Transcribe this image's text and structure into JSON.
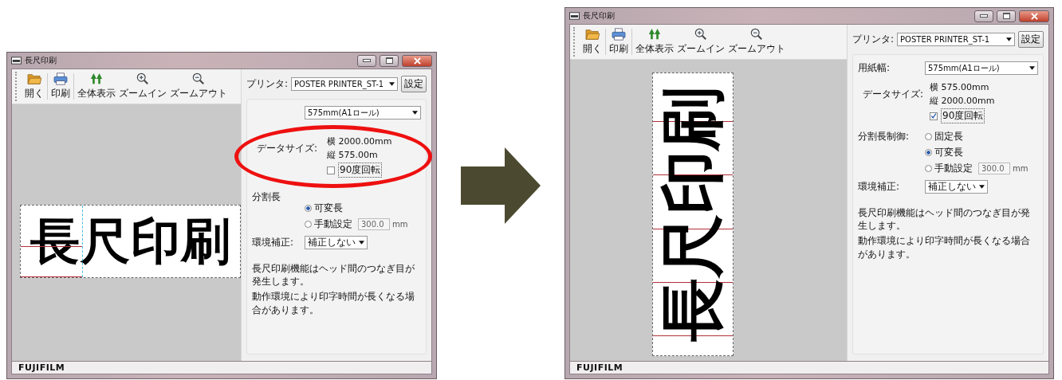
{
  "windows": [
    {
      "title": "長尺印刷",
      "highlighted": true,
      "toolbar": [
        {
          "kind": "open",
          "label": "開く"
        },
        {
          "kind": "print",
          "label": "印刷"
        },
        {
          "kind": "fit",
          "label": "全体表示"
        },
        {
          "kind": "zoom_in",
          "label": "ズームイン"
        },
        {
          "kind": "zoom_out",
          "label": "ズームアウト"
        }
      ],
      "preview": {
        "text": "長尺印刷"
      },
      "printer": {
        "label": "プリンタ:",
        "value": "POSTER PRINTER_ST-1",
        "button": "設定"
      },
      "paper_width": {
        "value": "575mm(A1ロール)"
      },
      "data_size": {
        "label": "データサイズ:",
        "width": "横 2000.00mm",
        "height": "縦 575.00m"
      },
      "rotate": {
        "label": "90度回転",
        "checked": false
      },
      "split": {
        "label": "分割長",
        "options": [
          {
            "label": "可変長",
            "selected": true
          },
          {
            "label": "手動設定",
            "selected": false
          }
        ],
        "manual_value": "300.0",
        "unit": "mm"
      },
      "correction": {
        "label": "環境補正:",
        "value": "補正しない"
      },
      "note": [
        "長尺印刷機能はヘッド間のつなぎ目が発生します。",
        "動作環境により印字時間が長くなる場合があります。"
      ],
      "status": "FUJIFILM"
    },
    {
      "title": "長尺印刷",
      "highlighted": false,
      "toolbar": [
        {
          "kind": "open",
          "label": "開く"
        },
        {
          "kind": "print",
          "label": "印刷"
        },
        {
          "kind": "fit",
          "label": "全体表示"
        },
        {
          "kind": "zoom_in",
          "label": "ズームイン"
        },
        {
          "kind": "zoom_out",
          "label": "ズームアウト"
        }
      ],
      "preview": {
        "text": "長尺印刷"
      },
      "printer": {
        "label": "プリンタ:",
        "value": "POSTER PRINTER_ST-1",
        "button": "設定"
      },
      "paper_width": {
        "label": "用紙幅:",
        "value": "575mm(A1ロール)"
      },
      "data_size": {
        "label": "データサイズ:",
        "width": "横 575.00mm",
        "height": "縦 2000.00mm"
      },
      "rotate": {
        "label": "90度回転",
        "checked": true
      },
      "split": {
        "label": "分割長制御:",
        "options": [
          {
            "label": "固定長",
            "selected": false
          },
          {
            "label": "可変長",
            "selected": true
          },
          {
            "label": "手動設定",
            "selected": false
          }
        ],
        "manual_value": "300.0",
        "unit": "mm"
      },
      "correction": {
        "label": "環境補正:",
        "value": "補正しない"
      },
      "note": [
        "長尺印刷機能はヘッド間のつなぎ目が発生します。",
        "動作環境により印字時間が長くなる場合があります。"
      ],
      "status": "FUJIFILM"
    }
  ]
}
